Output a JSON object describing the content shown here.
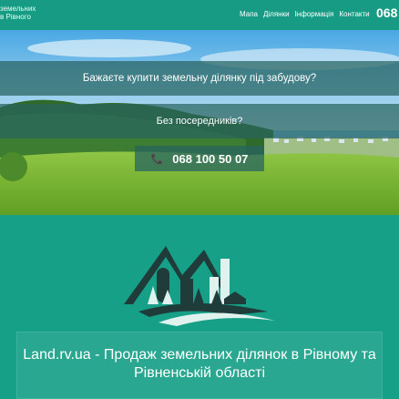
{
  "header": {
    "brand_line1": "земельних",
    "brand_line2": "в Рівного",
    "nav": [
      "Мапа",
      "Ділянки",
      "Інформація",
      "Контакти"
    ],
    "phone": "068"
  },
  "hero": {
    "question": "Бажаєте купити земельну ділянку під забудову?",
    "subtitle": "Без посередників?",
    "phone_button": "068 100 50 07"
  },
  "main": {
    "title": "Land.rv.ua - Продаж земельних ділянок в Рівному та Рівненській області"
  },
  "colors": {
    "primary": "#17a088",
    "banner": "#286460",
    "logo_dark": "#1f3b3a"
  },
  "icons": [
    "phone-icon"
  ]
}
